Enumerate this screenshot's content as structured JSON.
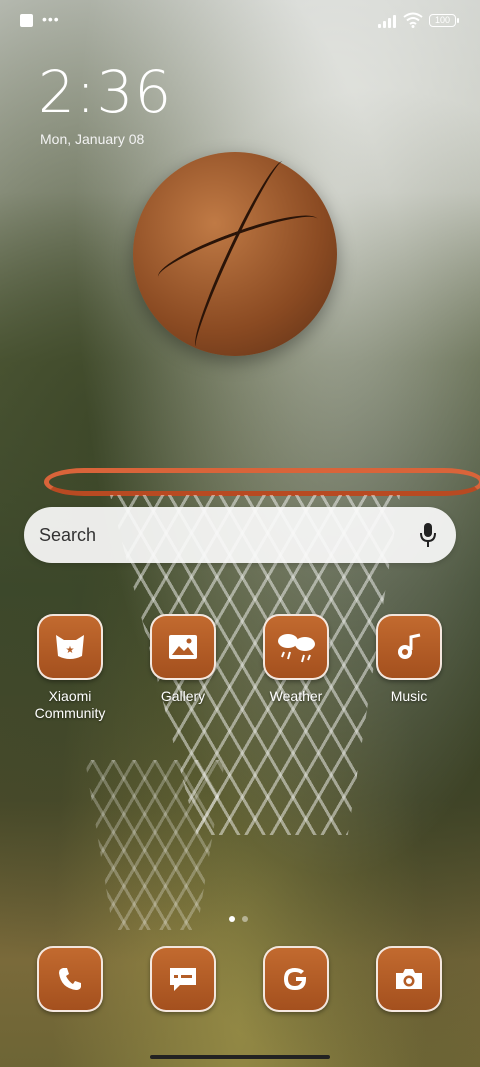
{
  "status_bar": {
    "battery": "100",
    "notification_dots": "•••"
  },
  "lockclock": {
    "time": "2:36",
    "date": "Mon, January 08"
  },
  "search": {
    "placeholder": "Search"
  },
  "apps": [
    {
      "label": "Xiaomi Community",
      "icon": "mi-community-icon"
    },
    {
      "label": "Gallery",
      "icon": "gallery-icon"
    },
    {
      "label": "Weather",
      "icon": "weather-icon"
    },
    {
      "label": "Music",
      "icon": "music-icon"
    }
  ],
  "dock": [
    {
      "icon": "phone-icon"
    },
    {
      "icon": "messages-icon"
    },
    {
      "icon": "google-icon"
    },
    {
      "icon": "camera-icon"
    }
  ],
  "theme": {
    "icon_color": "#b45d26"
  }
}
